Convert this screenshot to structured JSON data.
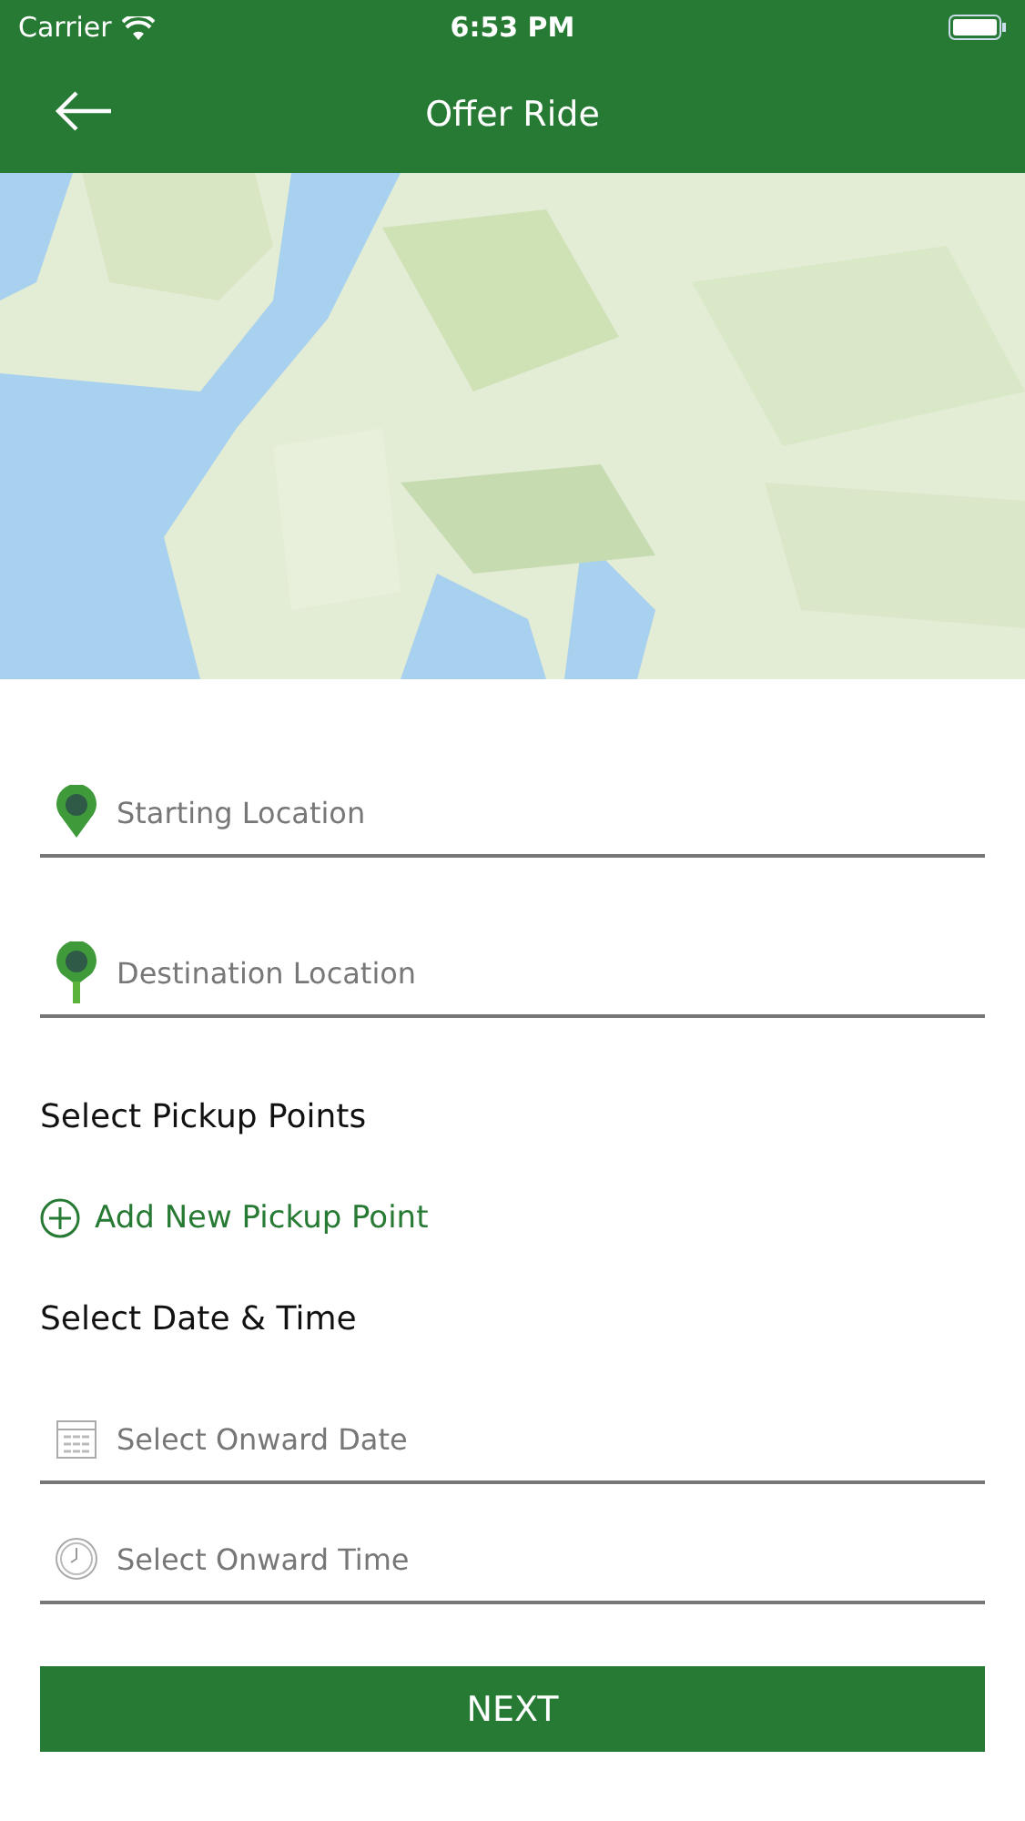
{
  "status_bar": {
    "carrier": "Carrier",
    "time": "6:53 PM"
  },
  "header": {
    "title": "Offer Ride"
  },
  "location_fields": [
    {
      "kind": "start-pin",
      "placeholder": "Starting Location"
    },
    {
      "kind": "end-pin",
      "placeholder": "Destination Location"
    }
  ],
  "pickup": {
    "heading": "Select Pickup Points",
    "add_label": "Add New Pickup Point"
  },
  "datetime": {
    "heading": "Select Date & Time",
    "fields": [
      {
        "kind": "calendar",
        "placeholder": "Select Onward Date"
      },
      {
        "kind": "clock",
        "placeholder": "Select Onward Time"
      }
    ]
  },
  "next_button": "NEXT"
}
